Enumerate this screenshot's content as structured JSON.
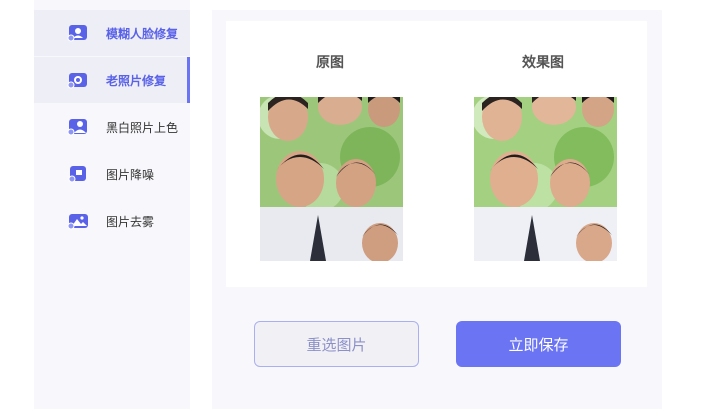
{
  "sidebar": {
    "items": [
      {
        "label": "模糊人脸修复",
        "icon": "face-restore-icon",
        "selected": true
      },
      {
        "label": "老照片修复",
        "icon": "old-photo-icon",
        "selected": true
      },
      {
        "label": "黑白照片上色",
        "icon": "colorize-icon",
        "selected": false
      },
      {
        "label": "图片降噪",
        "icon": "denoise-icon",
        "selected": false
      },
      {
        "label": "图片去雾",
        "icon": "dehaze-icon",
        "selected": false
      }
    ]
  },
  "compare": {
    "original_title": "原图",
    "result_title": "效果图"
  },
  "actions": {
    "reselect_label": "重选图片",
    "save_label": "立即保存"
  },
  "colors": {
    "accent": "#6b74f2",
    "sidebar_bg": "#f8f8fc"
  }
}
